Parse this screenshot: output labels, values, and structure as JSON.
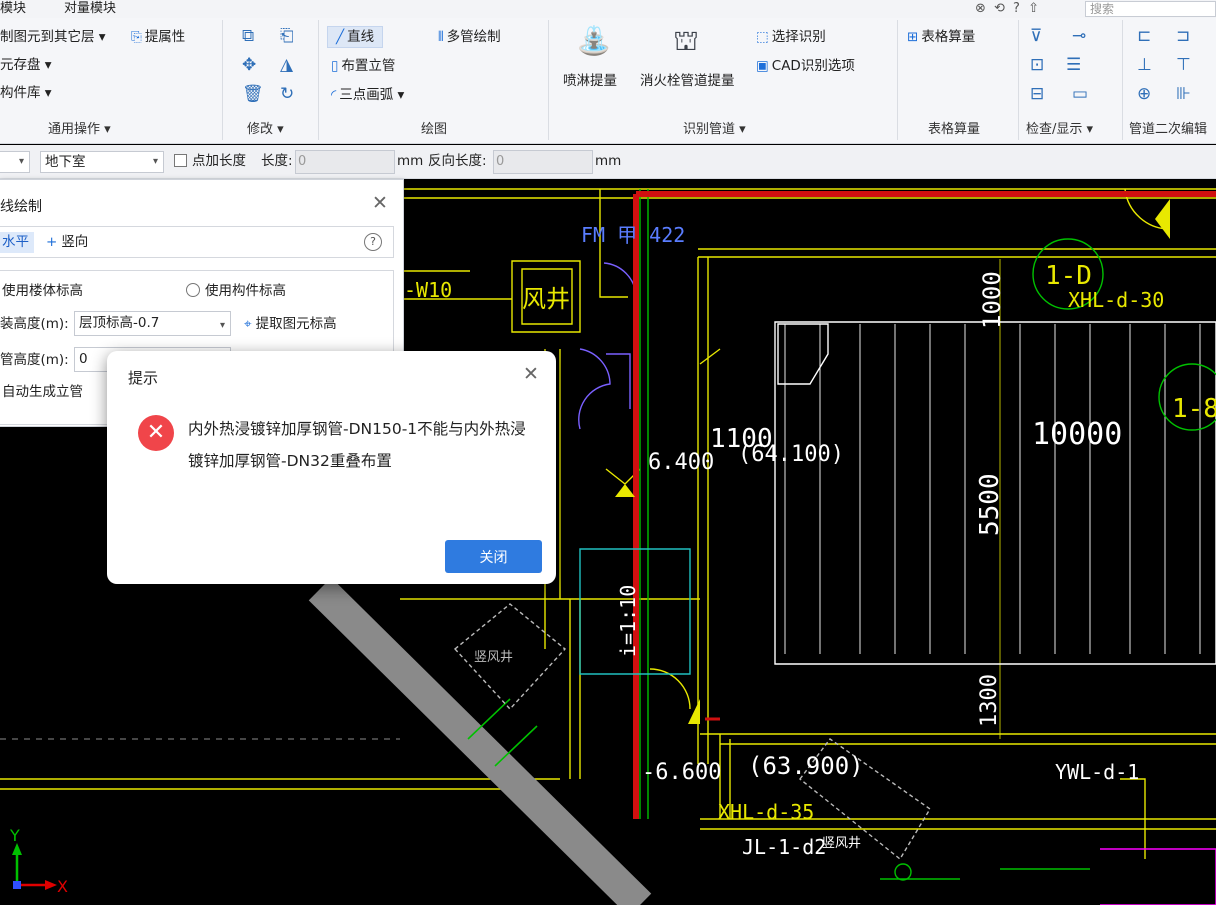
{
  "menubar": {
    "items": [
      "模块",
      "对量模块"
    ],
    "top_icons": "⊗ ⟲ ? ⇧",
    "search_placeholder": "搜索"
  },
  "ribbon": {
    "general": {
      "copy_to_layers": "制图元到其它层 ▾",
      "extract_attr": "提属性",
      "store": "元存盘 ▾",
      "library": "构件库 ▾",
      "group_label": "通用操作 ▾"
    },
    "modify": {
      "group_label": "修改 ▾"
    },
    "draw": {
      "line": "直线",
      "multi_pipe": "多管绘制",
      "riser": "布置立管",
      "arc": "三点画弧 ▾",
      "group_label": "绘图"
    },
    "identify": {
      "sprinkler": "喷淋提量",
      "hydrant": "消火栓管道提量",
      "select_identify": "选择识别",
      "cad_options": "CAD识别选项",
      "group_label": "识别管道 ▾"
    },
    "table": {
      "calc": "表格算量",
      "group_label": "表格算量"
    },
    "check": {
      "group_label": "检查/显示 ▾"
    },
    "secondary": {
      "group_label": "管道二次编辑"
    }
  },
  "propbar": {
    "floor": "地下室",
    "add_length": "点加长度",
    "length_label": "长度:",
    "length_value": "0",
    "unit": "mm",
    "reverse_label": "反向长度:",
    "reverse_value": "0",
    "unit2": "mm"
  },
  "panel": {
    "title": "线绘制",
    "tab_horizontal": "水平",
    "tab_vertical": "竖向",
    "help": "?",
    "use_floor_elev": "使用楼体标高",
    "use_comp_elev": "使用构件标高",
    "install_height_label": "装高度(m):",
    "install_height_value": "层顶标高-0.7",
    "extract_elev": "提取图元标高",
    "pipe_height_label": "管高度(m):",
    "pipe_height_value": "0",
    "auto_riser": "自动生成立管"
  },
  "dialog": {
    "title": "提示",
    "message": "内外热浸镀锌加厚钢管-DN150-1不能与内外热浸镀锌加厚钢管-DN32重叠布置",
    "close_button": "关闭"
  },
  "cad": {
    "labels": {
      "fm": "FM 甲 422",
      "w10": "-W10",
      "shaft": "风井",
      "tag_1d": "1-D",
      "xhl30": "XHL-d-30",
      "tag_18": "1-8",
      "d1000": "1000",
      "d1100": "1100",
      "d64100": "(64.100)",
      "d10000": "10000",
      "e6400": "6.400",
      "d5500": "5500",
      "slope": "i=1:10",
      "shaft2": "竖风井",
      "d1300": "1300",
      "e6600": "-6.600",
      "d63900": "(63.900)",
      "ywl1": "YWL-d-1",
      "xhl35": "XHL-d-35",
      "jl1": "JL-1-d2",
      "shaft3": "竖风井",
      "axis_y": "Y",
      "axis_x": "X"
    }
  },
  "colors": {
    "accent": "#2f7be0",
    "error": "#f0454a",
    "cad_yellow": "#e8e800",
    "cad_red": "#d01010",
    "cad_green": "#00c000",
    "cad_white": "#ffffff"
  }
}
